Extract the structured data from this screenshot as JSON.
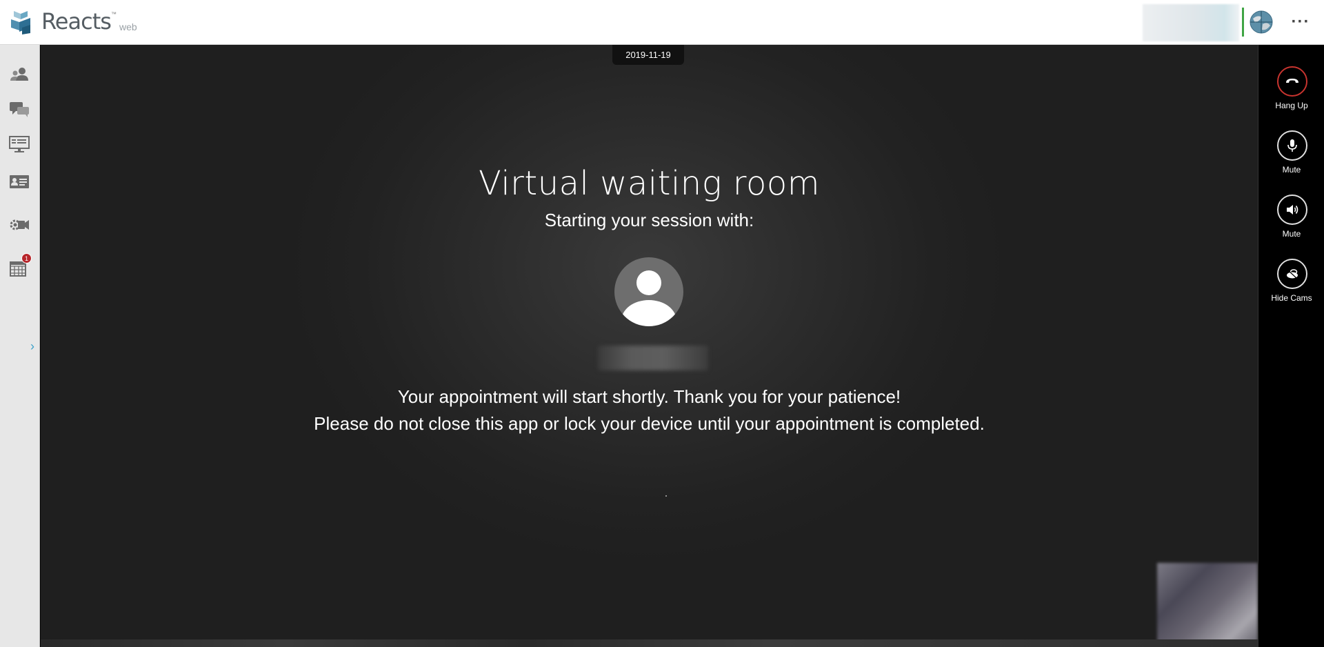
{
  "app": {
    "brand_name": "Reacts",
    "brand_tm": "™",
    "brand_suffix": "web"
  },
  "header": {
    "more_label": "···"
  },
  "sidebar": {
    "items": [
      {
        "name": "contacts",
        "icon": "contacts-icon"
      },
      {
        "name": "chat",
        "icon": "chat-icon"
      },
      {
        "name": "presentation",
        "icon": "presentation-icon"
      },
      {
        "name": "id-card",
        "icon": "id-card-icon"
      },
      {
        "name": "camera-settings",
        "icon": "camera-settings-icon"
      },
      {
        "name": "calendar",
        "icon": "calendar-icon",
        "badge": "1"
      }
    ],
    "expand_label": "›"
  },
  "stage": {
    "date": "2019-11-19",
    "title": "Virtual waiting room",
    "subtitle": "Starting your session with:",
    "message_line1": "Your appointment will start shortly. Thank you for your patience!",
    "message_line2": "Please do not close this app or lock your device until your appointment is completed."
  },
  "controls": [
    {
      "label": "Hang Up",
      "icon": "hang-up-icon",
      "color": "#c8342f"
    },
    {
      "label": "Mute",
      "icon": "microphone-icon"
    },
    {
      "label": "Mute",
      "icon": "speaker-icon"
    },
    {
      "label": "Hide Cams",
      "icon": "hide-cams-icon"
    }
  ],
  "colors": {
    "status_online": "#3fa544",
    "badge": "#b7262b",
    "accent": "#3aa0c8"
  }
}
